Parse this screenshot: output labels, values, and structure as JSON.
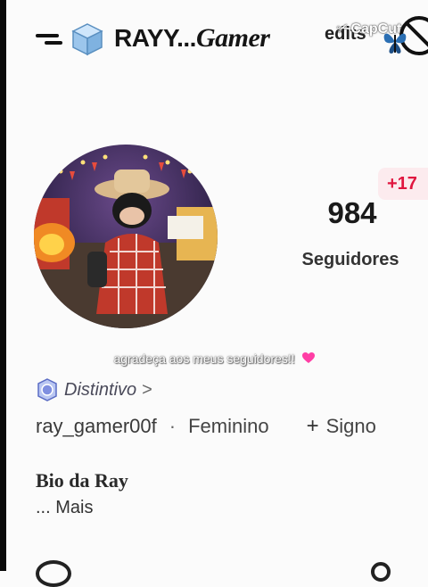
{
  "header": {
    "title_prefix": "RAYY...",
    "title_game": "Gamer",
    "edits_text": "edits",
    "watermark": "CapCut",
    "watermark_mark": "✂"
  },
  "profile": {
    "followers_count": "984",
    "followers_label": "Seguidores",
    "new_followers_badge": "+17",
    "caption": "agradeça aos meus seguidores!!",
    "badge_label": "Distintivo",
    "badge_chevron": ">",
    "username": "ray_gamer00f",
    "separator": "·",
    "gender": "Feminino",
    "sign_plus": "+",
    "sign_label": "Signo",
    "bio_title": "Bio da Ray",
    "bio_more": "... Mais"
  },
  "colors": {
    "accent_red": "#e0163f",
    "badge_bg": "#fcebee",
    "heart": "#ff3ea5"
  },
  "icons": [
    "cube-icon",
    "butterfly-icon",
    "ban-icon",
    "heart-icon",
    "badge-icon",
    "chevron-right-icon"
  ]
}
